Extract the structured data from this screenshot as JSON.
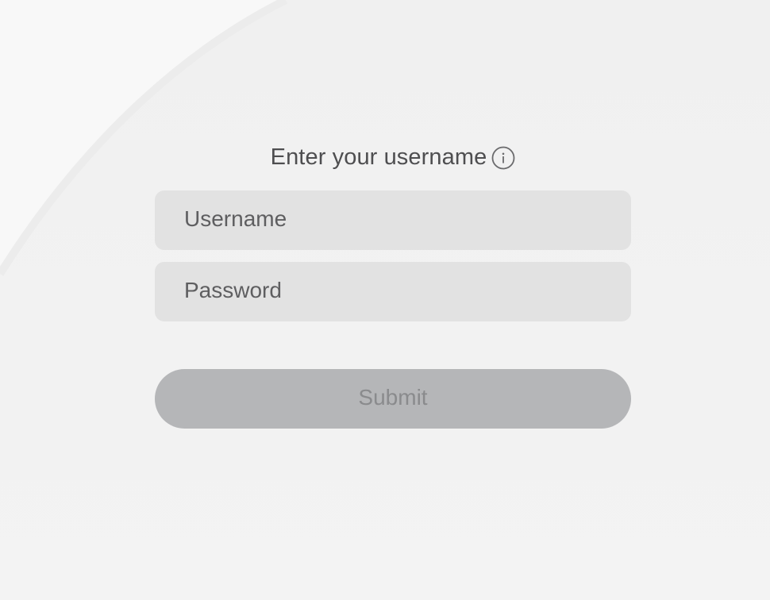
{
  "login": {
    "title": "Enter your username",
    "username_placeholder": "Username",
    "password_placeholder": "Password",
    "submit_label": "Submit",
    "info_icon": "info-icon"
  },
  "colors": {
    "background": "#f1f1f1",
    "field_background": "#e2e2e2",
    "button_background": "#b5b6b8",
    "button_text": "#8a8b8d",
    "title_text": "#4e4e50"
  }
}
